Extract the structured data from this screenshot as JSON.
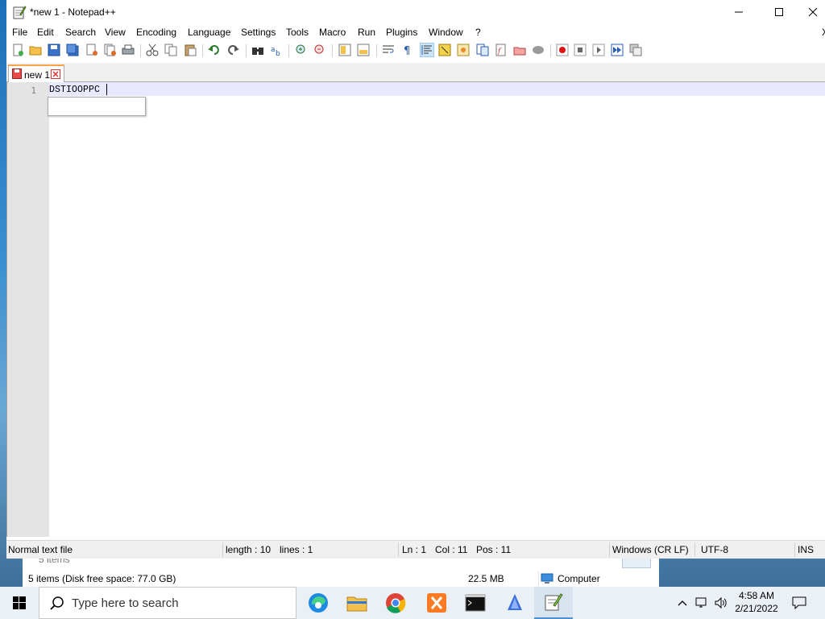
{
  "window": {
    "title": "*new 1 - Notepad++",
    "minimize": "—",
    "maximize": "☐",
    "close": "✕"
  },
  "menu": [
    "File",
    "Edit",
    "Search",
    "View",
    "Encoding",
    "Language",
    "Settings",
    "Tools",
    "Macro",
    "Run",
    "Plugins",
    "Window",
    "?"
  ],
  "menu_close": "X",
  "toolbar_icons": [
    "new-file-icon",
    "open-file-icon",
    "save-icon",
    "save-all-icon",
    "close-icon",
    "close-all-icon",
    "print-icon",
    "cut-icon",
    "copy-icon",
    "paste-icon",
    "undo-icon",
    "redo-icon",
    "find-icon",
    "replace-icon",
    "zoom-in-icon",
    "zoom-out-icon",
    "sync-vertical-icon",
    "sync-horizontal-icon",
    "word-wrap-icon",
    "show-all-chars-icon",
    "indent-guide-icon",
    "udl-icon",
    "doc-map-icon",
    "function-list-icon",
    "folder-as-workspace-icon",
    "doc-list-icon",
    "monitoring-icon",
    "record-macro-icon",
    "stop-macro-icon",
    "play-macro-icon",
    "run-macro-multiple-icon",
    "save-macro-icon"
  ],
  "tab": {
    "label": "new 1"
  },
  "editor": {
    "line_number": "1",
    "text": "DSTIOOPPC"
  },
  "status": {
    "file_type": "Normal text file",
    "length": "length : 10",
    "lines": "lines : 1",
    "ln": "Ln : 1",
    "col": "Col : 11",
    "pos": "Pos : 11",
    "eol": "Windows (CR LF)",
    "encoding": "UTF-8",
    "mode": "INS"
  },
  "explorer": {
    "items_ghost": "5 items",
    "status_left": "5 items (Disk free space: 77.0 GB)",
    "size": "22.5 MB",
    "location": "Computer"
  },
  "taskbar": {
    "search_placeholder": "Type here to search",
    "time": "4:58 AM",
    "date": "2/21/2022",
    "apps": [
      "edge-icon",
      "file-explorer-icon",
      "chrome-icon",
      "xampp-icon",
      "terminal-icon",
      "app-icon",
      "notepadpp-icon"
    ]
  },
  "colors": {
    "accent_tab": "#f9a64a",
    "current_line": "#e8e8ff",
    "gutter": "#e4e4e4",
    "taskbar": "#eaf0f6"
  }
}
